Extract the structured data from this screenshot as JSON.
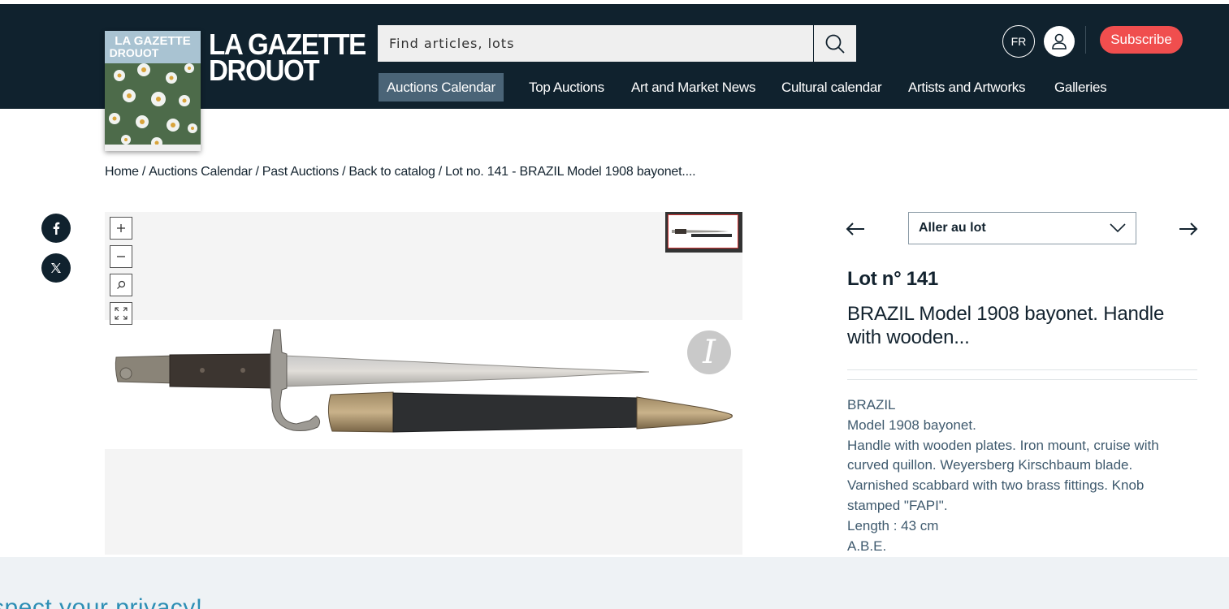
{
  "header": {
    "logo_line1": "LA GAZETTE",
    "logo_line2": "DROUOT",
    "search_placeholder": "Find articles, lots",
    "lang": "FR",
    "subscribe_label": "Subscribe",
    "cover": {
      "line1": "LA GAZETTE",
      "line2": "DROUOT"
    },
    "nav": [
      {
        "label": "Auctions Calendar",
        "active": true
      },
      {
        "label": "Top Auctions",
        "active": false
      },
      {
        "label": "Art and Market News",
        "active": false
      },
      {
        "label": "Cultural calendar",
        "active": false
      },
      {
        "label": "Artists and Artworks",
        "active": false
      },
      {
        "label": "Galleries",
        "active": false
      }
    ]
  },
  "breadcrumb": {
    "items": [
      "Home",
      "Auctions Calendar",
      "Past Auctions",
      "Back to catalog",
      "Lot no. 141 - BRAZIL Model 1908 bayonet...."
    ],
    "separator": "/"
  },
  "social": [
    "facebook-icon",
    "x-icon"
  ],
  "viewer": {
    "controls": [
      "zoom-in-icon",
      "zoom-out-icon",
      "search-icon",
      "fullscreen-icon"
    ],
    "watermark": "I"
  },
  "lot": {
    "goto_label": "Aller au lot",
    "number": "Lot n° 141",
    "title": "BRAZIL Model 1908 bayonet. Handle with wooden...",
    "description": [
      "BRAZIL",
      "Model 1908 bayonet.",
      "Handle with wooden plates. Iron mount, cruise with",
      "curved quillon. Weyersberg Kirschbaum blade.",
      "Varnished scabbard with two brass fittings. Knob",
      "stamped \"FAPI\".",
      "Length : 43 cm",
      "A.B.E."
    ]
  },
  "cookie": {
    "title": "spect your privacy!"
  },
  "colors": {
    "header_bg": "#10222e",
    "subscribe": "#f04e4e",
    "nav_active": "#4a6477",
    "desc_text": "#3f5a6e",
    "cookie_title": "#2e8fb5"
  }
}
